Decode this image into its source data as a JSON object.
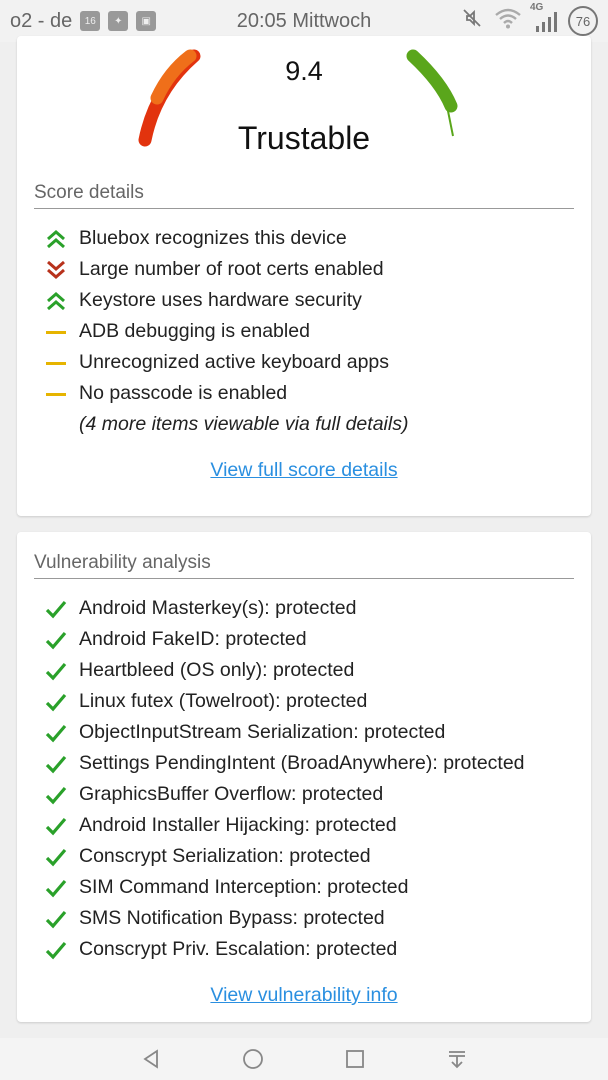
{
  "status_bar": {
    "carrier": "o2 - de",
    "notification_badges": [
      "16",
      "",
      ""
    ],
    "time": "20:05 Mittwoch",
    "network": "4G",
    "battery": "76"
  },
  "score_card": {
    "score": "9.4",
    "rating": "Trustable",
    "section_title": "Score details",
    "items": [
      {
        "label": "Bluebox recognizes this device",
        "icon": "double-chevron-up-icon"
      },
      {
        "label": "Large number of root certs enabled",
        "icon": "double-chevron-down-icon"
      },
      {
        "label": "Keystore uses hardware security",
        "icon": "double-chevron-up-icon"
      },
      {
        "label": "ADB debugging is enabled",
        "icon": "dash-icon"
      },
      {
        "label": "Unrecognized active keyboard apps",
        "icon": "dash-icon"
      },
      {
        "label": "No passcode is enabled",
        "icon": "dash-icon"
      }
    ],
    "more_note": "(4 more items viewable via full details)",
    "link": "View full score details"
  },
  "vuln_card": {
    "section_title": "Vulnerability analysis",
    "items": [
      "Android Masterkey(s): protected",
      "Android FakeID: protected",
      "Heartbleed (OS only): protected",
      "Linux futex (Towelroot): protected",
      "ObjectInputStream Serialization: protected",
      "Settings PendingIntent (BroadAnywhere): protected",
      "GraphicsBuffer Overflow: protected",
      "Android Installer Hijacking: protected",
      "Conscrypt Serialization: protected",
      "SIM Command Interception: protected",
      "SMS Notification Bypass: protected",
      "Conscrypt Priv. Escalation: protected"
    ],
    "link": "View vulnerability info"
  },
  "colors": {
    "good": "#2aa12a",
    "bad": "#b8321c",
    "warn": "#e6b400",
    "link": "#2a8fe0"
  }
}
